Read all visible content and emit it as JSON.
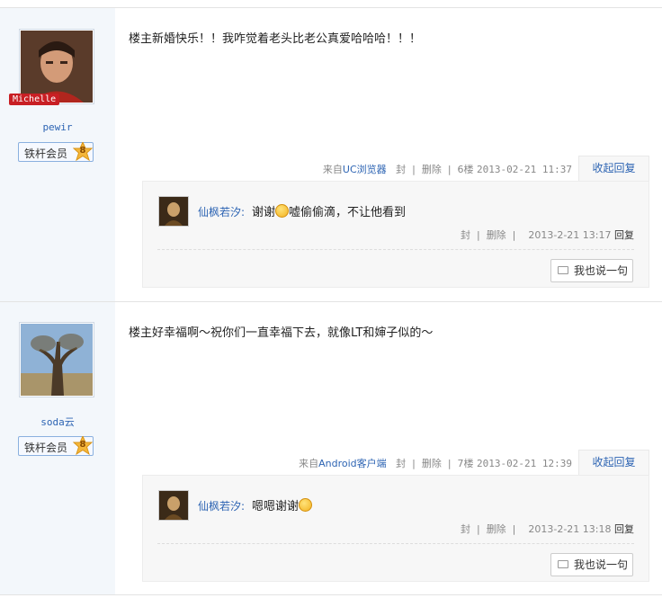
{
  "posts": [
    {
      "author": "pewir",
      "avatar_badge": "Michelle",
      "rank_label": "铁杆会员",
      "rank_level": "8",
      "content": "楼主新婚快乐！！我咋觉着老头比老公真爱哈哈哈！！！",
      "meta": {
        "from": "来自",
        "source": "UC浏览器",
        "report": "封",
        "delete": "删除",
        "floor": "6楼",
        "time": "2013-02-21 11:37"
      },
      "toggle_label": "收起回复",
      "reply": {
        "name": "仙枫若汐:",
        "text_before": "谢谢",
        "text_after": "嘘偷偷滴，不让他看到",
        "meta": {
          "report": "封",
          "delete": "删除",
          "time": "2013-2-21 13:17",
          "reply": "回复"
        }
      },
      "say_label": "我也说一句"
    },
    {
      "author": "soda云",
      "rank_label": "铁杆会员",
      "rank_level": "8",
      "content": "楼主好幸福啊～祝你们一直幸福下去，就像LT和婶子似的～",
      "meta": {
        "from": "来自",
        "source": "Android客户端",
        "report": "封",
        "delete": "删除",
        "floor": "7楼",
        "time": "2013-02-21 12:39"
      },
      "toggle_label": "收起回复",
      "reply": {
        "name": "仙枫若汐:",
        "text_before": "嗯嗯谢谢",
        "text_after": "",
        "meta": {
          "report": "封",
          "delete": "删除",
          "time": "2013-2-21 13:18",
          "reply": "回复"
        }
      },
      "say_label": "我也说一句"
    }
  ],
  "colors": {
    "link": "#2d64b3",
    "sidebar": "#f3f7fb",
    "badge": "#c81f24"
  }
}
